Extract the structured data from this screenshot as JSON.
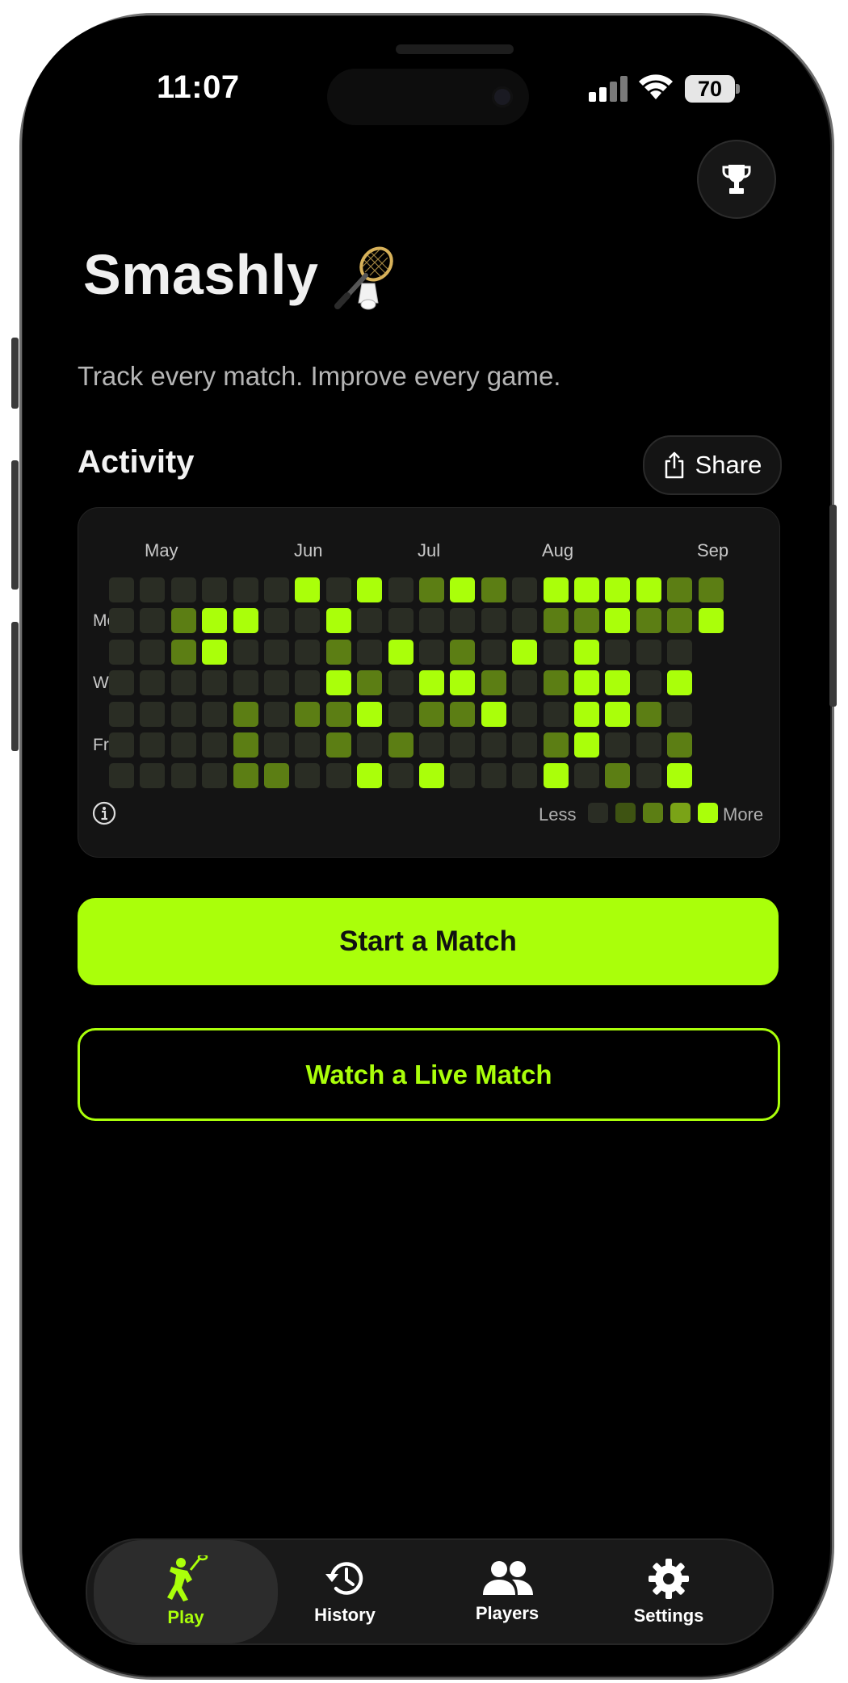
{
  "status_bar": {
    "time": "11:07",
    "battery": "70"
  },
  "app": {
    "title": "Smashly",
    "subtitle": "Track every match. Improve every game."
  },
  "activity": {
    "label": "Activity",
    "share_label": "Share",
    "months": [
      "May",
      "Jun",
      "Jul",
      "Aug",
      "Sep"
    ],
    "day_labels": [
      "Mon",
      "Wed",
      "Fri"
    ],
    "legend_less": "Less",
    "legend_more": "More",
    "levels": [
      [
        0,
        0,
        0,
        0,
        0,
        0,
        4,
        0,
        4,
        0,
        2,
        4,
        2,
        0,
        4,
        4,
        4,
        4,
        2,
        2
      ],
      [
        0,
        0,
        2,
        4,
        4,
        0,
        0,
        4,
        0,
        0,
        0,
        0,
        0,
        0,
        2,
        2,
        4,
        2,
        2,
        4
      ],
      [
        0,
        0,
        2,
        4,
        0,
        0,
        0,
        2,
        0,
        4,
        0,
        2,
        0,
        4,
        0,
        4,
        0,
        0,
        0,
        -1
      ],
      [
        0,
        0,
        0,
        0,
        0,
        0,
        0,
        4,
        2,
        0,
        4,
        4,
        2,
        0,
        2,
        4,
        4,
        0,
        4,
        -1
      ],
      [
        0,
        0,
        0,
        0,
        2,
        0,
        2,
        2,
        4,
        0,
        2,
        2,
        4,
        0,
        0,
        4,
        4,
        2,
        0,
        -1
      ],
      [
        0,
        0,
        0,
        0,
        2,
        0,
        0,
        2,
        0,
        2,
        0,
        0,
        0,
        0,
        2,
        4,
        0,
        0,
        2,
        -1
      ],
      [
        0,
        0,
        0,
        0,
        2,
        2,
        0,
        0,
        4,
        0,
        4,
        0,
        0,
        0,
        4,
        0,
        2,
        0,
        4,
        -1
      ]
    ]
  },
  "buttons": {
    "start_match": "Start a Match",
    "watch_live": "Watch a Live Match"
  },
  "tabbar": {
    "tabs": [
      {
        "label": "Play",
        "icon": "player-smash-icon",
        "active": true
      },
      {
        "label": "History",
        "icon": "history-icon",
        "active": false
      },
      {
        "label": "Players",
        "icon": "players-icon",
        "active": false
      },
      {
        "label": "Settings",
        "icon": "gear-icon",
        "active": false
      }
    ]
  },
  "colors": {
    "accent": "#aaff0a",
    "background": "#000000",
    "card": "#141414"
  }
}
